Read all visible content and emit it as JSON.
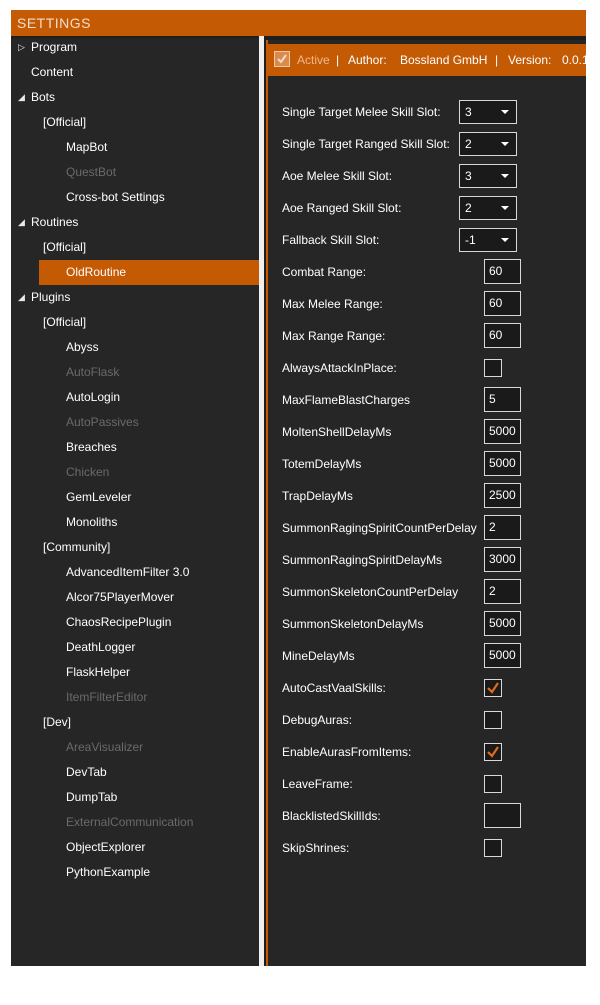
{
  "window": {
    "title": "SETTINGS"
  },
  "tree": {
    "nodes": [
      {
        "label": "Program",
        "level": 0,
        "expander": "collapsed",
        "disabled": false,
        "selected": false
      },
      {
        "label": "Content",
        "level": 0,
        "expander": "none",
        "disabled": false,
        "selected": false
      },
      {
        "label": "Bots",
        "level": 0,
        "expander": "expanded",
        "disabled": false,
        "selected": false
      },
      {
        "label": "[Official]",
        "level": 1,
        "expander": "none",
        "disabled": false,
        "selected": false
      },
      {
        "label": "MapBot",
        "level": 2,
        "expander": "none",
        "disabled": false,
        "selected": false
      },
      {
        "label": "QuestBot",
        "level": 2,
        "expander": "none",
        "disabled": true,
        "selected": false
      },
      {
        "label": "Cross-bot Settings",
        "level": 2,
        "expander": "none",
        "disabled": false,
        "selected": false
      },
      {
        "label": "Routines",
        "level": 0,
        "expander": "expanded",
        "disabled": false,
        "selected": false
      },
      {
        "label": "[Official]",
        "level": 1,
        "expander": "none",
        "disabled": false,
        "selected": false
      },
      {
        "label": "OldRoutine",
        "level": 2,
        "expander": "none",
        "disabled": false,
        "selected": true
      },
      {
        "label": "Plugins",
        "level": 0,
        "expander": "expanded",
        "disabled": false,
        "selected": false
      },
      {
        "label": "[Official]",
        "level": 1,
        "expander": "none",
        "disabled": false,
        "selected": false
      },
      {
        "label": "Abyss",
        "level": 2,
        "expander": "none",
        "disabled": false,
        "selected": false
      },
      {
        "label": "AutoFlask",
        "level": 2,
        "expander": "none",
        "disabled": true,
        "selected": false
      },
      {
        "label": "AutoLogin",
        "level": 2,
        "expander": "none",
        "disabled": false,
        "selected": false
      },
      {
        "label": "AutoPassives",
        "level": 2,
        "expander": "none",
        "disabled": true,
        "selected": false
      },
      {
        "label": "Breaches",
        "level": 2,
        "expander": "none",
        "disabled": false,
        "selected": false
      },
      {
        "label": "Chicken",
        "level": 2,
        "expander": "none",
        "disabled": true,
        "selected": false
      },
      {
        "label": "GemLeveler",
        "level": 2,
        "expander": "none",
        "disabled": false,
        "selected": false
      },
      {
        "label": "Monoliths",
        "level": 2,
        "expander": "none",
        "disabled": false,
        "selected": false
      },
      {
        "label": "[Community]",
        "level": 1,
        "expander": "none",
        "disabled": false,
        "selected": false
      },
      {
        "label": "AdvancedItemFilter 3.0",
        "level": 2,
        "expander": "none",
        "disabled": false,
        "selected": false
      },
      {
        "label": "Alcor75PlayerMover",
        "level": 2,
        "expander": "none",
        "disabled": false,
        "selected": false
      },
      {
        "label": "ChaosRecipePlugin",
        "level": 2,
        "expander": "none",
        "disabled": false,
        "selected": false
      },
      {
        "label": "DeathLogger",
        "level": 2,
        "expander": "none",
        "disabled": false,
        "selected": false
      },
      {
        "label": "FlaskHelper",
        "level": 2,
        "expander": "none",
        "disabled": false,
        "selected": false
      },
      {
        "label": "ItemFilterEditor",
        "level": 2,
        "expander": "none",
        "disabled": true,
        "selected": false
      },
      {
        "label": "[Dev]",
        "level": 1,
        "expander": "none",
        "disabled": false,
        "selected": false
      },
      {
        "label": "AreaVisualizer",
        "level": 2,
        "expander": "none",
        "disabled": true,
        "selected": false
      },
      {
        "label": "DevTab",
        "level": 2,
        "expander": "none",
        "disabled": false,
        "selected": false
      },
      {
        "label": "DumpTab",
        "level": 2,
        "expander": "none",
        "disabled": false,
        "selected": false
      },
      {
        "label": "ExternalCommunication",
        "level": 2,
        "expander": "none",
        "disabled": true,
        "selected": false
      },
      {
        "label": "ObjectExplorer",
        "level": 2,
        "expander": "none",
        "disabled": false,
        "selected": false
      },
      {
        "label": "PythonExample",
        "level": 2,
        "expander": "none",
        "disabled": false,
        "selected": false
      }
    ]
  },
  "header": {
    "active_label": "Active",
    "active_checked": true,
    "sep1": "|",
    "author_label": "Author:",
    "author_value": "Bossland GmbH",
    "sep2": "|",
    "version_label": "Version:",
    "version_value": "0.0.1"
  },
  "settings": [
    {
      "label": "Single Target Melee Skill Slot:",
      "control": "combo",
      "value": "3"
    },
    {
      "label": "Single Target Ranged Skill Slot:",
      "control": "combo",
      "value": "2"
    },
    {
      "label": "Aoe Melee Skill Slot:",
      "control": "combo",
      "value": "3"
    },
    {
      "label": "Aoe Ranged Skill Slot:",
      "control": "combo",
      "value": "2"
    },
    {
      "label": "Fallback Skill Slot:",
      "control": "combo",
      "value": "-1"
    },
    {
      "label": "Combat Range:",
      "control": "text",
      "value": "60"
    },
    {
      "label": "Max Melee Range:",
      "control": "text",
      "value": "60"
    },
    {
      "label": "Max Range Range:",
      "control": "text",
      "value": "60"
    },
    {
      "label": "AlwaysAttackInPlace:",
      "control": "check",
      "checked": false
    },
    {
      "label": "MaxFlameBlastCharges",
      "control": "text",
      "value": "5"
    },
    {
      "label": "MoltenShellDelayMs",
      "control": "text",
      "value": "5000"
    },
    {
      "label": "TotemDelayMs",
      "control": "text",
      "value": "5000"
    },
    {
      "label": "TrapDelayMs",
      "control": "text",
      "value": "2500"
    },
    {
      "label": "SummonRagingSpiritCountPerDelay",
      "control": "text",
      "value": "2"
    },
    {
      "label": "SummonRagingSpiritDelayMs",
      "control": "text",
      "value": "3000"
    },
    {
      "label": "SummonSkeletonCountPerDelay",
      "control": "text",
      "value": "2"
    },
    {
      "label": "SummonSkeletonDelayMs",
      "control": "text",
      "value": "5000"
    },
    {
      "label": "MineDelayMs",
      "control": "text",
      "value": "5000"
    },
    {
      "label": "AutoCastVaalSkills:",
      "control": "check",
      "checked": true
    },
    {
      "label": "DebugAuras:",
      "control": "check",
      "checked": false
    },
    {
      "label": "EnableAurasFromItems:",
      "control": "check",
      "checked": true
    },
    {
      "label": "LeaveFrame:",
      "control": "check",
      "checked": false
    },
    {
      "label": "BlacklistedSkillIds:",
      "control": "text",
      "value": ""
    },
    {
      "label": "SkipShrines:",
      "control": "check",
      "checked": false
    }
  ],
  "colors": {
    "accent": "#c55a05",
    "background": "#262626",
    "disabled_text": "#6a6a6a",
    "check_mark": "#e06c1a"
  },
  "icons": {
    "collapsed": "triangle-right-icon",
    "expanded": "triangle-down-icon",
    "check": "checkmark-icon",
    "dropdown": "chevron-down-icon"
  }
}
